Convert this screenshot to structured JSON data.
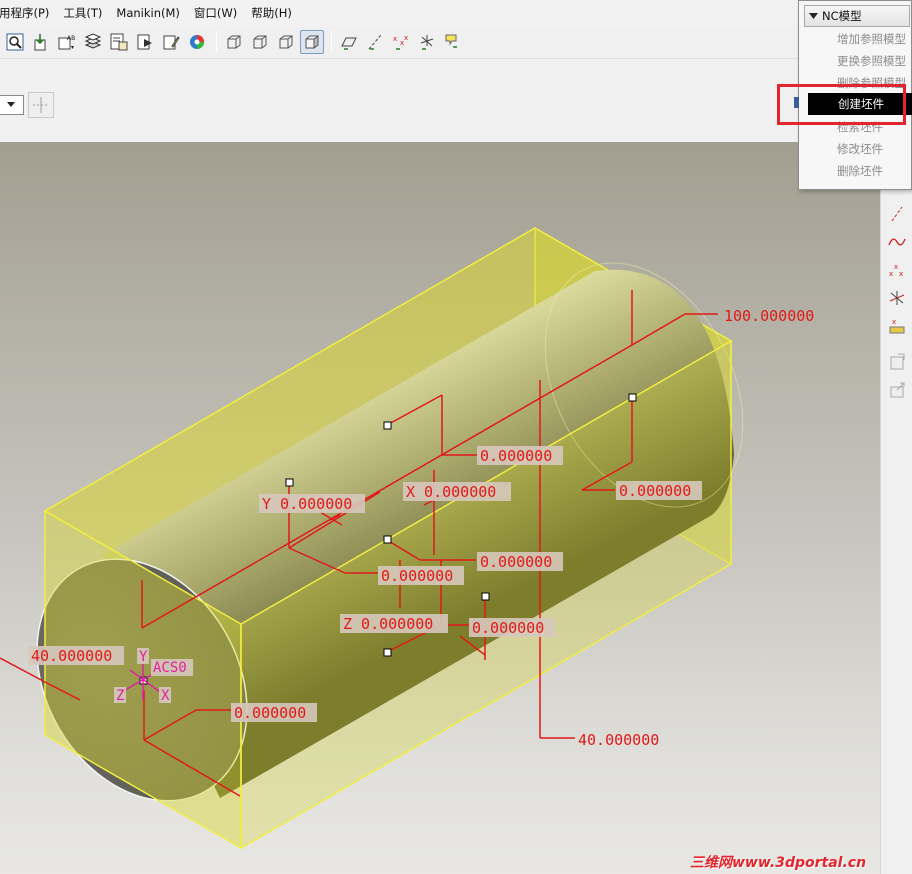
{
  "menubar": {
    "items": [
      "用程序(P)",
      "工具(T)",
      "Manikin(M)",
      "窗口(W)",
      "帮助(H)"
    ]
  },
  "toolbar": {
    "icons": [
      "zoom-window-icon",
      "import-icon",
      "annotate-icon",
      "layers-icon",
      "model-tree-icon",
      "paste-special-icon",
      "edit-icon",
      "color-wheel-icon",
      "wireframe-icon",
      "hidden-line-icon",
      "no-hidden-icon",
      "shaded-icon",
      "datum-plane-display-icon",
      "datum-axis-display-icon",
      "datum-point-display-icon",
      "csys-display-icon",
      "annotation-display-icon"
    ]
  },
  "nc_menu": {
    "title": "NC模型",
    "items": [
      "增加参照模型",
      "更换参照模型",
      "删除参照模型",
      "创建坯件",
      "检索坯件",
      "修改坯件",
      "删除坯件"
    ],
    "selected": "创建坯件",
    "highlight_color": "#e3262e"
  },
  "dimensions": {
    "length": "100.000000",
    "width": "40.000000",
    "height": "40.000000",
    "offset_top": "0.000000",
    "offset_right": "0.000000",
    "y_offset": "Y 0.000000",
    "x_offset": "X 0.000000",
    "offset_mid": "0.000000",
    "offset_center": "0.000000",
    "z_offset": "Z 0.000000",
    "offset_lower": "0.000000",
    "offset_front": "0.000000"
  },
  "csys": {
    "name": "ACS0",
    "y_label": "Y",
    "x_label": "X",
    "z_label": "Z"
  },
  "colors": {
    "workpiece": "#d8d630",
    "dimension": "#e11919",
    "csys": "#e020a0"
  },
  "watermark": "三维网www.3dportal.cn"
}
